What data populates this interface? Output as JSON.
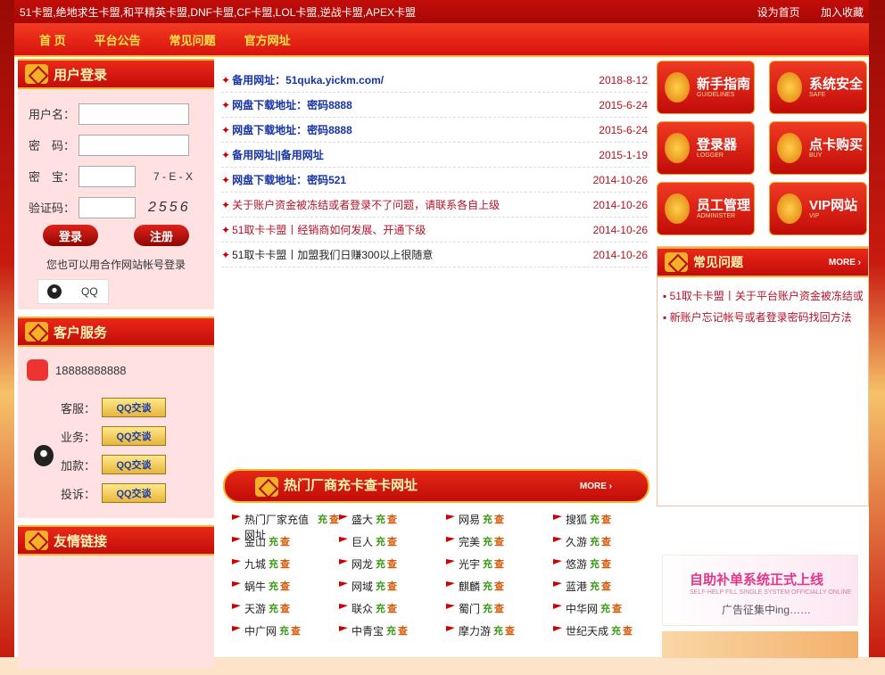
{
  "top": {
    "title": "51卡盟,绝地求生卡盟,和平精英卡盟,DNF卡盟,CF卡盟,LOL卡盟,逆战卡盟,APEX卡盟",
    "links": [
      "设为首页",
      "加入收藏"
    ]
  },
  "nav": [
    "首 页",
    "平台公告",
    "常见问题",
    "官方网址"
  ],
  "login": {
    "title": "用户登录",
    "username_label": "用户名：",
    "password_label": "密　码：",
    "secret_label": "密　宝：",
    "secret_hint": "7 - E - X",
    "captcha_label": "验证码：",
    "captcha_code": "2556",
    "login_btn": "登录",
    "register_btn": "注册",
    "partner_text": "您也可以用合作网站帐号登录",
    "qq_label": "QQ"
  },
  "service": {
    "title": "客户服务",
    "phone": "18888888888",
    "rows": [
      "客服：",
      "业务：",
      "加款：",
      "投诉："
    ],
    "qq_btn": "QQ交谈"
  },
  "links_panel": {
    "title": "友情链接"
  },
  "news": [
    {
      "text": "备用网址：51quka.yickm.com/",
      "date": "2018-8-12",
      "style": ""
    },
    {
      "text": "网盘下载地址：密码8888",
      "date": "2015-6-24",
      "style": ""
    },
    {
      "text": "网盘下载地址：密码8888",
      "date": "2015-6-24",
      "style": ""
    },
    {
      "text": "备用网址||备用网址",
      "date": "2015-1-19",
      "style": ""
    },
    {
      "text": "网盘下载地址：密码521",
      "date": "2014-10-26",
      "style": ""
    },
    {
      "text": "关于账户资金被冻结或者登录不了问题，请联系各自上级",
      "date": "2014-10-26",
      "style": "red"
    },
    {
      "text": "51取卡卡盟丨经销商如何发展、开通下级",
      "date": "2014-10-26",
      "style": "red"
    },
    {
      "text": "51取卡卡盟丨加盟我们日赚300以上很随意",
      "date": "2014-10-26",
      "style": "dark"
    }
  ],
  "hot": {
    "title": "热门厂商充卡查卡网址",
    "more": "MORE ›",
    "tag_charge": "充",
    "tag_check": "查",
    "items": [
      "热门厂家充值网址",
      "盛大",
      "网易",
      "搜狐",
      "金山",
      "巨人",
      "完美",
      "久游",
      "九城",
      "网龙",
      "光宇",
      "悠游",
      "蜗牛",
      "网域",
      "麒麟",
      "蓝港",
      "天游",
      "联众",
      "蜀门",
      "中华网",
      "中广网",
      "中青宝",
      "摩力游",
      "世纪天成"
    ]
  },
  "tiles": [
    {
      "title": "新手指南",
      "sub": "GUIDELINES"
    },
    {
      "title": "系统安全",
      "sub": "SAFE"
    },
    {
      "title": "登录器",
      "sub": "LOGGER"
    },
    {
      "title": "点卡购买",
      "sub": "BUY"
    },
    {
      "title": "员工管理",
      "sub": "ADMINISTER"
    },
    {
      "title": "VIP网站",
      "sub": "VIP"
    }
  ],
  "faq": {
    "title": "常见问题",
    "more": "MORE ›",
    "items": [
      "▪ 51取卡卡盟丨关于平台账户资金被冻结或",
      "▪ 新账户忘记帐号或者登录密码找回方法"
    ]
  },
  "banner": {
    "line1": "自助补单系统正式上线",
    "line2": "SELF-HELP FILL SINGLE SYSTEM OFFICIALLY ONLINE",
    "line3": "广告征集中ing……"
  }
}
